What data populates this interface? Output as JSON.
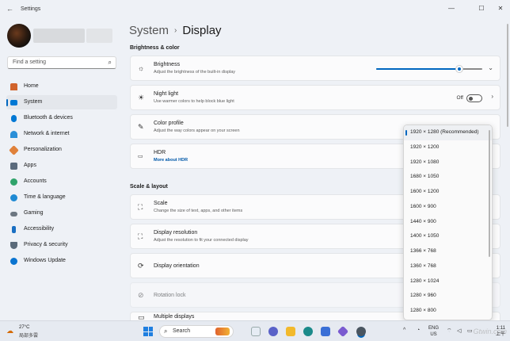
{
  "window": {
    "title": "Settings",
    "back_glyph": "←",
    "minimize_glyph": "—",
    "maximize_glyph": "☐",
    "close_glyph": "✕"
  },
  "sidebar": {
    "search_placeholder": "Find a setting",
    "items": [
      {
        "label": "Home",
        "icon": "home-icon",
        "color": "#d1632b"
      },
      {
        "label": "System",
        "icon": "system-icon",
        "color": "#0078d4",
        "active": true
      },
      {
        "label": "Bluetooth & devices",
        "icon": "bluetooth-icon",
        "color": "#0078d4"
      },
      {
        "label": "Network & internet",
        "icon": "wifi-icon",
        "color": "#2a8fd8"
      },
      {
        "label": "Personalization",
        "icon": "brush-icon",
        "color": "#e0813a"
      },
      {
        "label": "Apps",
        "icon": "apps-icon",
        "color": "#5b6b7d"
      },
      {
        "label": "Accounts",
        "icon": "person-icon",
        "color": "#2fa36b"
      },
      {
        "label": "Time & language",
        "icon": "globe-clock-icon",
        "color": "#1f8ad3"
      },
      {
        "label": "Gaming",
        "icon": "gamepad-icon",
        "color": "#6d7782"
      },
      {
        "label": "Accessibility",
        "icon": "accessibility-icon",
        "color": "#1a6fc2"
      },
      {
        "label": "Privacy & security",
        "icon": "shield-icon",
        "color": "#5a6a7a"
      },
      {
        "label": "Windows Update",
        "icon": "update-icon",
        "color": "#0a74d0"
      }
    ]
  },
  "main": {
    "breadcrumb_parent": "System",
    "breadcrumb_sep": "›",
    "breadcrumb_current": "Display",
    "section_brightness": "Brightness & color",
    "section_scale": "Scale & layout",
    "brightness": {
      "title": "Brightness",
      "subtitle": "Adjust the brightness of the built-in display",
      "level": 0.78
    },
    "night_light": {
      "title": "Night light",
      "subtitle": "Use warmer colors to help block blue light",
      "state": "Off"
    },
    "color_profile": {
      "title": "Color profile",
      "subtitle": "Adjust the way colors appear on your screen"
    },
    "hdr": {
      "title": "HDR",
      "link": "More about HDR"
    },
    "scale": {
      "title": "Scale",
      "subtitle": "Change the size of text, apps, and other items"
    },
    "resolution": {
      "title": "Display resolution",
      "subtitle": "Adjust the resolution to fit your connected display"
    },
    "orientation": {
      "title": "Display orientation"
    },
    "rotation_lock": {
      "title": "Rotation lock"
    },
    "multiple_displays": {
      "title": "Multiple displays"
    }
  },
  "resolution_dropdown": {
    "options": [
      "1920 × 1280 (Recommended)",
      "1920 × 1200",
      "1920 × 1080",
      "1680 × 1050",
      "1600 × 1200",
      "1600 × 900",
      "1440 × 900",
      "1400 × 1050",
      "1366 × 768",
      "1360 × 768",
      "1280 × 1024",
      "1280 × 960",
      "1280 × 800"
    ],
    "selected_index": 0
  },
  "taskbar": {
    "temperature": "27°C",
    "weather_condition": "局部多雲",
    "search_label": "Search",
    "lang_top": "ENG",
    "lang_bottom": "US",
    "time": "1:11",
    "date": "上午"
  },
  "watermark": "Gtwin.com"
}
